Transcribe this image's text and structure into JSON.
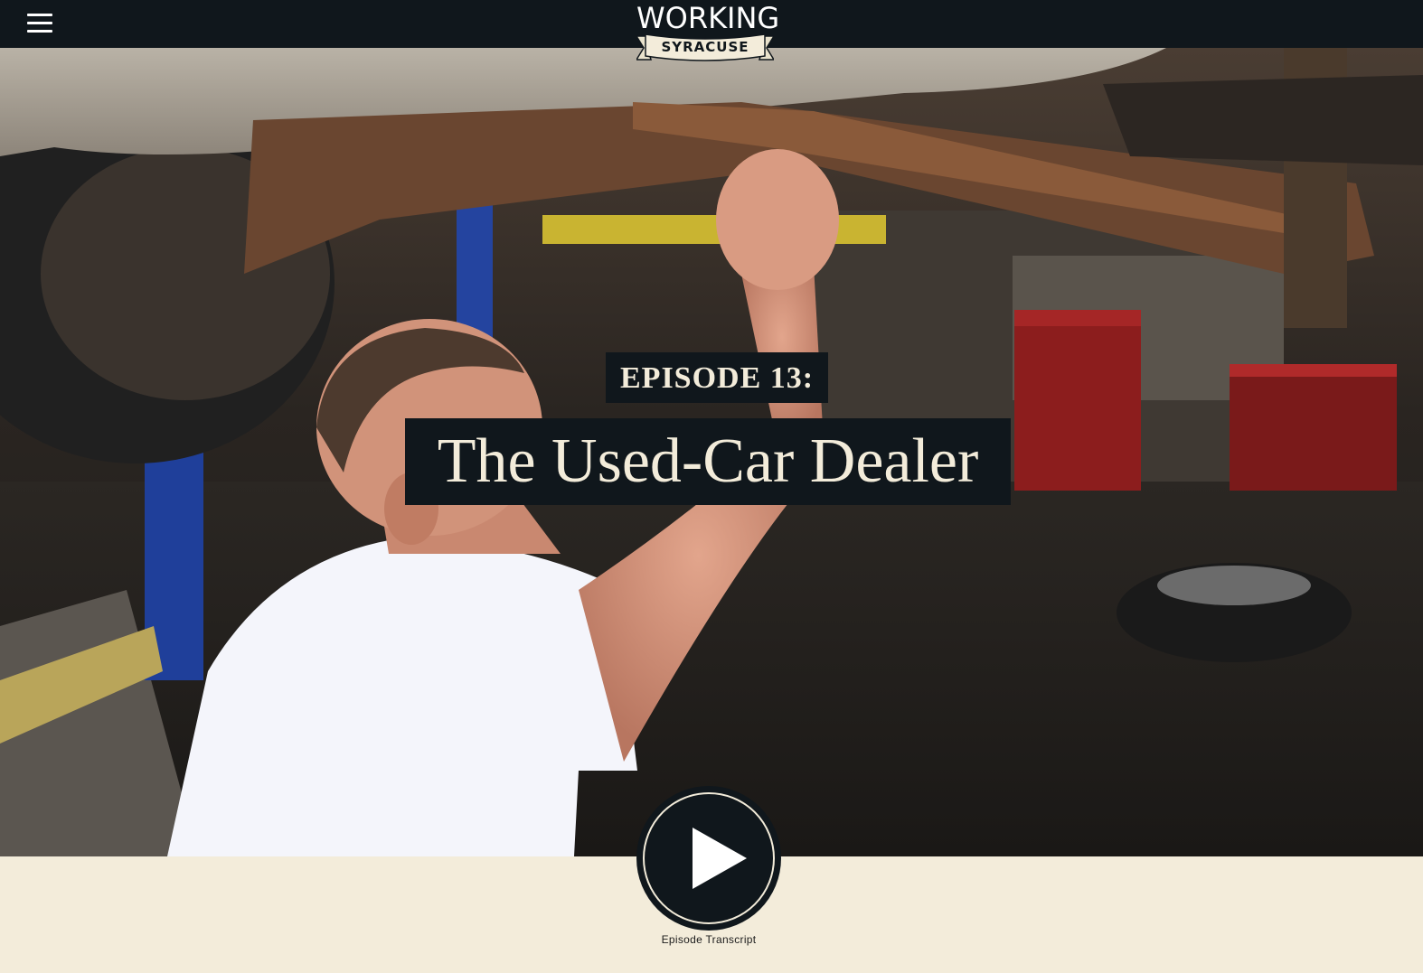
{
  "header": {
    "logo_word": "WORKING",
    "logo_sub": "SYRACUSE"
  },
  "hero": {
    "episode_label": "EPISODE 13:",
    "episode_title": "The Used-Car Dealer"
  },
  "footer": {
    "transcript_link": "Episode Transcript"
  },
  "icons": {
    "menu": "hamburger-menu-icon",
    "play": "play-icon"
  },
  "colors": {
    "nav_background": "#10171c",
    "label_background": "#10171c",
    "label_text": "#f3ecda",
    "page_background": "#f3ecda"
  }
}
